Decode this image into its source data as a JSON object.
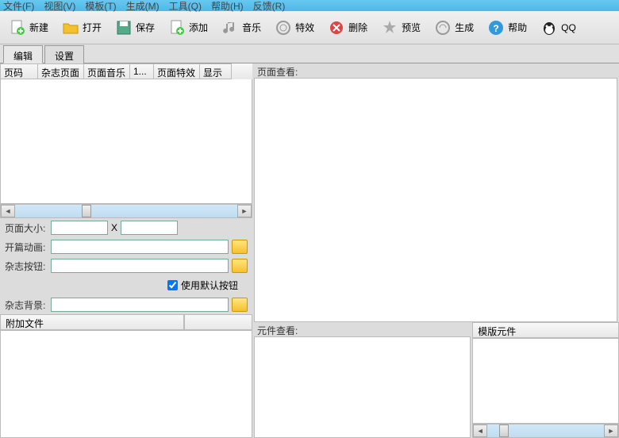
{
  "menu": {
    "items": [
      "文件(F)",
      "视图(V)",
      "模板(T)",
      "生成(M)",
      "工具(Q)",
      "帮助(H)",
      "反馈(R)"
    ]
  },
  "toolbar": {
    "new": "新建",
    "open": "打开",
    "save": "保存",
    "add": "添加",
    "music": "音乐",
    "effect": "特效",
    "delete": "删除",
    "preview": "预览",
    "generate": "生成",
    "help": "帮助",
    "qq": "QQ"
  },
  "tabs": {
    "edit": "编辑",
    "settings": "设置"
  },
  "grid": {
    "cols": [
      "页码",
      "杂志页面",
      "页面音乐",
      "1...",
      "页面特效",
      "显示"
    ]
  },
  "form": {
    "page_size": "页面大小:",
    "x": "X",
    "open_anim": "开篇动画:",
    "mag_button": "杂志按钮:",
    "default_btn": "使用默认按钮",
    "mag_bg": "杂志背景:"
  },
  "attach": {
    "title": "附加文件"
  },
  "viewer": {
    "page": "页面查看:",
    "element": "元件查看:",
    "template": "模版元件"
  }
}
